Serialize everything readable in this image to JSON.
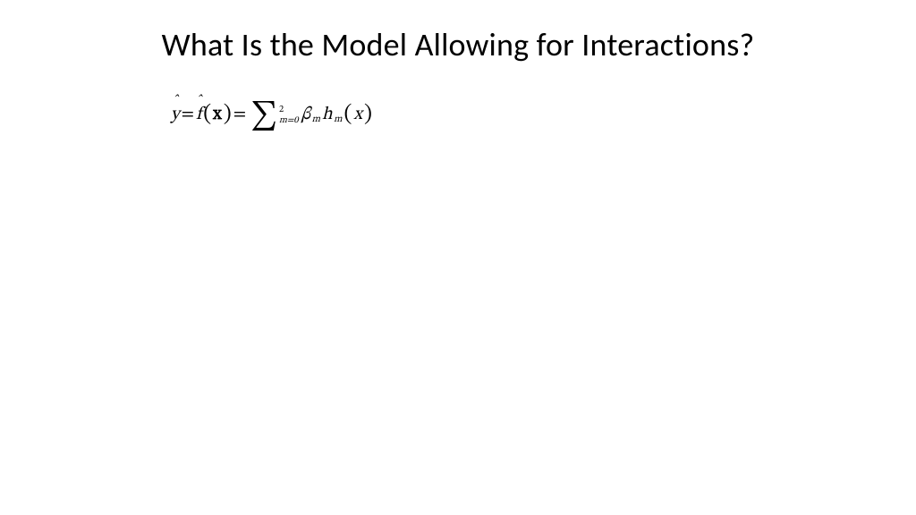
{
  "title": "What Is the Model Allowing for Interactions?",
  "equation": {
    "yhat_var": "y",
    "hat_char": "ˆ",
    "eq": "=",
    "f_var": "f",
    "lparen": "(",
    "rparen": ")",
    "x_vec": "x",
    "sigma": "∑",
    "sum_upper": "2",
    "sum_lower": "m=0",
    "beta": "β",
    "sub_m": "m",
    "h_var": "h",
    "x_scalar": "x"
  }
}
